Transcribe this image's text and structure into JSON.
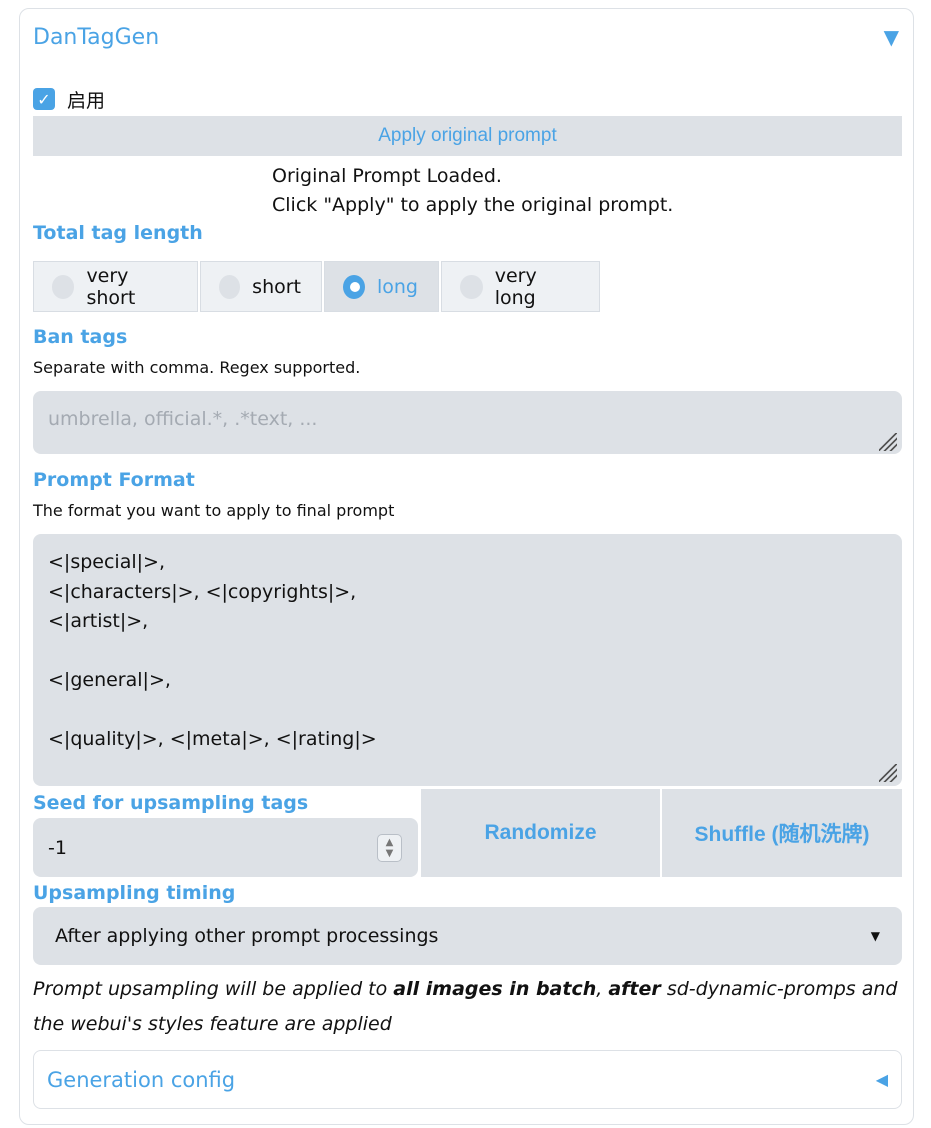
{
  "panel": {
    "title": "DanTagGen",
    "toggle_icon": "▼"
  },
  "enable": {
    "label": "启用",
    "checked": true,
    "check_glyph": "✓"
  },
  "apply_button": {
    "label": "Apply original prompt"
  },
  "status": {
    "line1": "Original Prompt Loaded.",
    "line2": "Click \"Apply\" to apply the original prompt."
  },
  "tag_length": {
    "label": "Total tag length",
    "options": [
      "very short",
      "short",
      "long",
      "very long"
    ],
    "selected": "long"
  },
  "ban_tags": {
    "label": "Ban tags",
    "info": "Separate with comma. Regex supported.",
    "placeholder": "umbrella, official.*, .*text, ...",
    "value": ""
  },
  "prompt_format": {
    "label": "Prompt Format",
    "info": "The format you want to apply to final prompt",
    "value": "<|special|>,\n<|characters|>, <|copyrights|>,\n<|artist|>,\n\n<|general|>,\n\n<|quality|>, <|meta|>, <|rating|>"
  },
  "seed": {
    "label": "Seed for upsampling tags",
    "value": "-1",
    "spin_up": "▲",
    "spin_down": "▼",
    "randomize_label": "Randomize",
    "shuffle_label": "Shuffle (随机洗牌)"
  },
  "timing": {
    "label": "Upsampling timing",
    "selected": "After applying other prompt processings",
    "arrow": "▼"
  },
  "note": {
    "part1": "Prompt upsampling will be applied to ",
    "bold1": "all images in batch",
    "part2": ", ",
    "bold2": "after",
    "part3": " sd-dynamic-promps and the webui's styles feature are applied"
  },
  "generation_config": {
    "title": "Generation config",
    "icon": "◀"
  },
  "colors": {
    "accent": "#4aa3e5",
    "surface": "#dde1e6",
    "text": "#111111"
  }
}
